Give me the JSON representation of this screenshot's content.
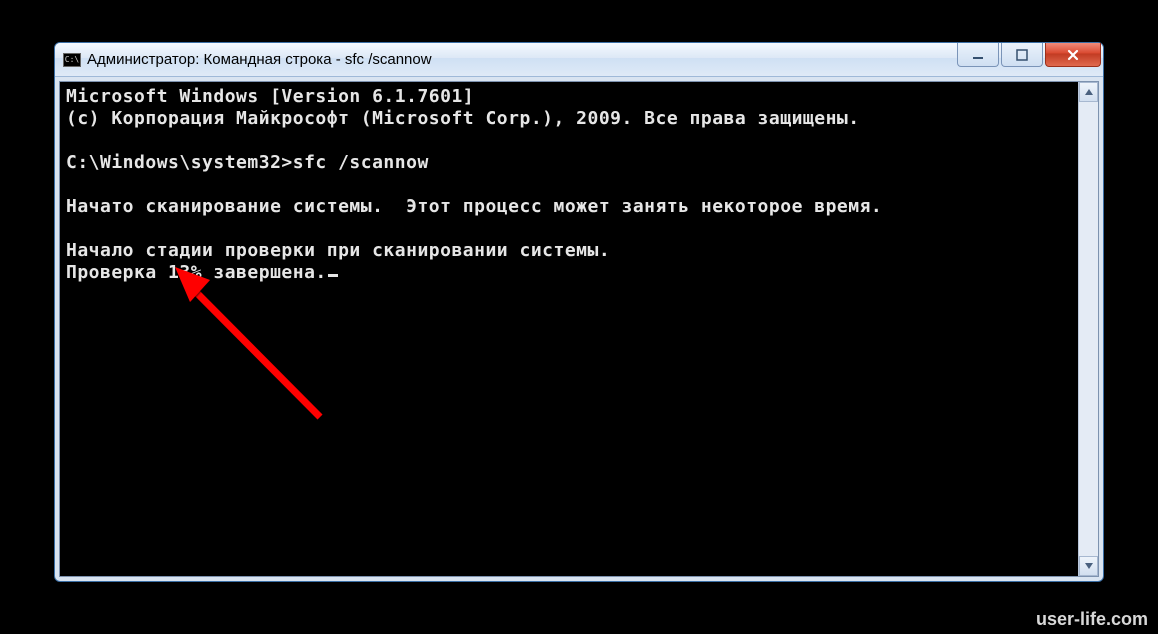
{
  "window": {
    "title": "Администратор: Командная строка - sfc  /scannow"
  },
  "terminal": {
    "lines": [
      "Microsoft Windows [Version 6.1.7601]",
      "(c) Корпорация Майкрософт (Microsoft Corp.), 2009. Все права защищены.",
      "",
      "C:\\Windows\\system32>sfc /scannow",
      "",
      "Начато сканирование системы.  Этот процесс может занять некоторое время.",
      "",
      "Начало стадии проверки при сканировании системы.",
      "Проверка 13% завершена."
    ]
  },
  "watermark": "user-life.com"
}
